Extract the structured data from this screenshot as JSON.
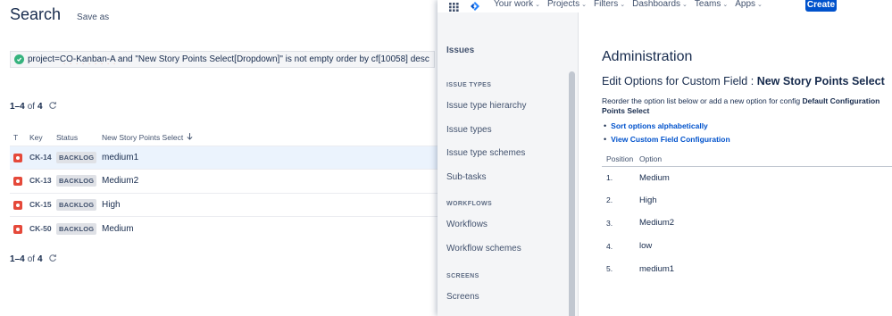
{
  "search": {
    "title": "Search",
    "save_as": "Save as",
    "jql_prefix": "project=",
    "jql_project": "CO-Kanban-A",
    "jql_rest": " and \"New Story Points Select[Dropdown]\" is not empty order by cf[10058] desc",
    "pager": {
      "range": "1–4",
      "of": "of",
      "total": "4"
    },
    "columns": [
      "T",
      "Key",
      "Status",
      "New Story Points Select"
    ],
    "rows": [
      {
        "key": "CK-14",
        "status": "BACKLOG",
        "points": "medium1",
        "selected": true
      },
      {
        "key": "CK-13",
        "status": "BACKLOG",
        "points": "Medium2",
        "selected": false
      },
      {
        "key": "CK-15",
        "status": "BACKLOG",
        "points": "High",
        "selected": false
      },
      {
        "key": "CK-50",
        "status": "BACKLOG",
        "points": "Medium",
        "selected": false
      }
    ]
  },
  "nav": {
    "items": [
      "Your work",
      "Projects",
      "Filters",
      "Dashboards",
      "Teams",
      "Apps"
    ],
    "create": "Create"
  },
  "sidebar": {
    "title": "Issues",
    "groups": [
      {
        "label": "ISSUE TYPES",
        "items": [
          "Issue type hierarchy",
          "Issue types",
          "Issue type schemes",
          "Sub-tasks"
        ]
      },
      {
        "label": "WORKFLOWS",
        "items": [
          "Workflows",
          "Workflow schemes"
        ]
      },
      {
        "label": "SCREENS",
        "items": [
          "Screens"
        ]
      }
    ]
  },
  "admin": {
    "title": "Administration",
    "edit_prefix": "Edit Options for Custom Field : ",
    "field_name": "New Story Points Select",
    "desc_prefix": "Reorder the option list below or add a new option for config ",
    "config_name": "Default Configuration",
    "desc_line2": "Points Select",
    "links": [
      "Sort options alphabetically",
      "View Custom Field Configuration"
    ],
    "columns": [
      "Position",
      "Option"
    ],
    "options": [
      {
        "pos": "1.",
        "name": "Medium"
      },
      {
        "pos": "2.",
        "name": "High"
      },
      {
        "pos": "3.",
        "name": "Medium2"
      },
      {
        "pos": "4.",
        "name": "low"
      },
      {
        "pos": "5.",
        "name": "medium1"
      }
    ]
  },
  "colors": {
    "accent": "#0052cc",
    "bug": "#e5493a",
    "success": "#36b37e",
    "lozenge_bg": "#dfe1e6"
  }
}
